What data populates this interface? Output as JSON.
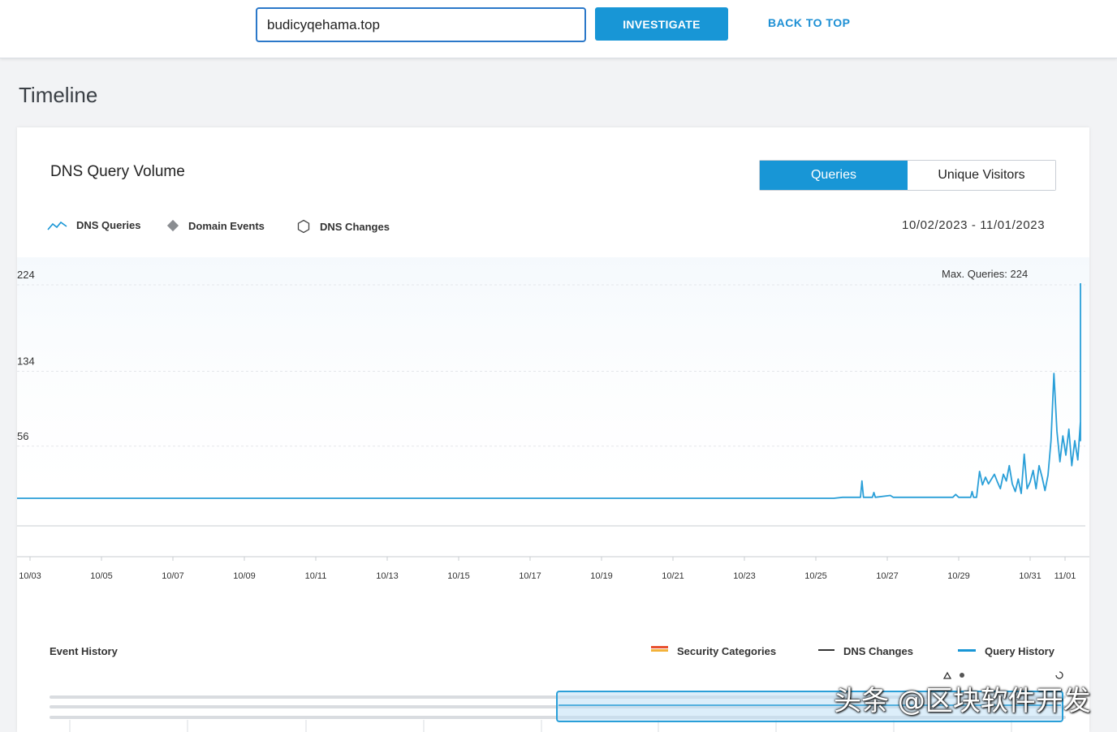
{
  "search": {
    "value": "budicyqehama.top"
  },
  "toolbar": {
    "investigate_label": "INVESTIGATE",
    "back_to_top_label": "BACK TO TOP"
  },
  "section": {
    "title": "Timeline"
  },
  "card": {
    "title": "DNS Query Volume",
    "toggle": {
      "queries_label": "Queries",
      "unique_visitors_label": "Unique Visitors",
      "active": "Queries"
    },
    "legend": {
      "dns_queries": "DNS Queries",
      "domain_events": "Domain Events",
      "dns_changes": "DNS Changes"
    },
    "date_range": "10/02/2023 - 11/01/2023"
  },
  "colors": {
    "accent": "#1896d6",
    "line": "#2a9fd8",
    "link": "#1c8fd4",
    "security": "#e8502f"
  },
  "chart_data": {
    "type": "line",
    "title": "DNS Query Volume",
    "annotation": "Max. Queries: 224",
    "ylim": [
      0,
      224
    ],
    "y_ticks": [
      224,
      134,
      56
    ],
    "x_ticks": [
      "10/03",
      "10/05",
      "10/07",
      "10/09",
      "10/11",
      "10/13",
      "10/15",
      "10/17",
      "10/19",
      "10/21",
      "10/23",
      "10/25",
      "10/27",
      "10/29",
      "10/31",
      "11/01"
    ],
    "x_range": [
      "10/02/2023",
      "11/01/2023"
    ],
    "series": [
      {
        "name": "DNS Queries",
        "points": [
          [
            "10/02 00:00",
            0
          ],
          [
            "10/25 12:00",
            0
          ],
          [
            "10/25 18:00",
            1
          ],
          [
            "10/26 06:00",
            1
          ],
          [
            "10/26 07:00",
            18
          ],
          [
            "10/26 08:00",
            1
          ],
          [
            "10/26 14:00",
            1
          ],
          [
            "10/26 15:00",
            6
          ],
          [
            "10/26 16:00",
            1
          ],
          [
            "10/27 02:00",
            3
          ],
          [
            "10/27 04:00",
            1
          ],
          [
            "10/28 20:00",
            1
          ],
          [
            "10/28 22:00",
            4
          ],
          [
            "10/29 00:00",
            1
          ],
          [
            "10/29 08:00",
            1
          ],
          [
            "10/29 09:00",
            7
          ],
          [
            "10/29 10:00",
            1
          ],
          [
            "10/29 12:00",
            1
          ],
          [
            "10/29 14:00",
            28
          ],
          [
            "10/29 16:00",
            14
          ],
          [
            "10/29 18:00",
            22
          ],
          [
            "10/29 20:00",
            15
          ],
          [
            "10/30 00:00",
            25
          ],
          [
            "10/30 02:00",
            17
          ],
          [
            "10/30 04:00",
            10
          ],
          [
            "10/30 06:00",
            25
          ],
          [
            "10/30 08:00",
            18
          ],
          [
            "10/30 10:00",
            34
          ],
          [
            "10/30 12:00",
            15
          ],
          [
            "10/30 14:00",
            7
          ],
          [
            "10/30 16:00",
            20
          ],
          [
            "10/30 18:00",
            5
          ],
          [
            "10/30 20:00",
            46
          ],
          [
            "10/30 22:00",
            10
          ],
          [
            "10/31 00:00",
            17
          ],
          [
            "10/31 02:00",
            29
          ],
          [
            "10/31 04:00",
            10
          ],
          [
            "10/31 06:00",
            34
          ],
          [
            "10/31 08:00",
            22
          ],
          [
            "10/31 10:00",
            8
          ],
          [
            "10/31 12:00",
            24
          ],
          [
            "10/31 14:00",
            60
          ],
          [
            "10/31 16:00",
            130
          ],
          [
            "10/31 18:00",
            70
          ],
          [
            "10/31 20:00",
            38
          ],
          [
            "10/31 22:00",
            65
          ],
          [
            "11/01 00:00",
            45
          ],
          [
            "11/01 02:00",
            72
          ],
          [
            "11/01 04:00",
            34
          ],
          [
            "11/01 06:00",
            60
          ],
          [
            "11/01 08:00",
            40
          ],
          [
            "11/01 10:00",
            80
          ],
          [
            "11/01 12:00",
            60
          ],
          [
            "11/01 14:00",
            118
          ],
          [
            "11/01 16:00",
            95
          ],
          [
            "11/01 18:00",
            138
          ],
          [
            "11/01 20:00",
            90
          ],
          [
            "11/01 22:00",
            150
          ],
          [
            "11/01 23:00",
            224
          ]
        ]
      }
    ],
    "grid": true
  },
  "event_history": {
    "title": "Event History",
    "legend": {
      "security_categories": "Security Categories",
      "dns_changes": "DNS Changes",
      "query_history": "Query History"
    },
    "brush": {
      "from": "10/25",
      "to": "11/01"
    }
  },
  "watermark": "头条 @区块软件开发"
}
